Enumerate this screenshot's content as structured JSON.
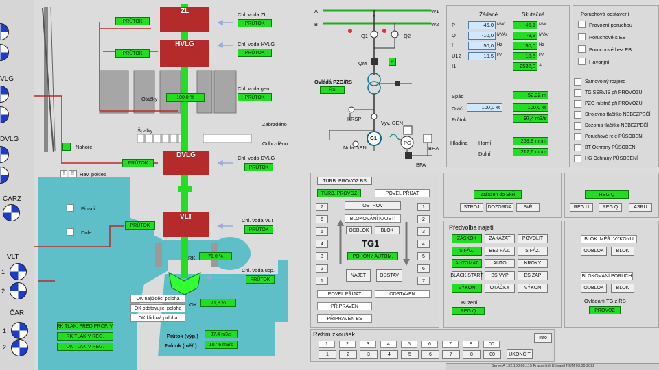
{
  "colors": {
    "green": "#22dd22",
    "red_block": "#b52b2b",
    "water": "#5fbfc9",
    "blue_indicator": "#1e3cc8"
  },
  "left": {
    "labels": [
      "VLG",
      "DVLG",
      "ČARZ",
      "VLT",
      "ČAR"
    ],
    "vlt_nums": [
      "1",
      "2"
    ],
    "car_nums": [
      "1",
      "2"
    ],
    "nahore": "Nahoře",
    "hav_pokles": "Hav. pokles",
    "hav_icons": [
      "!",
      "!!"
    ],
    "pinsci": "Pinsci",
    "dole": "Dole",
    "rk_labels": [
      "RK TLAK. PŘED PROP. V.",
      "RK TLAK V REG.",
      "OK TLAK V REG."
    ]
  },
  "turbine": {
    "zl": "ZL",
    "hvlg": "HVLG",
    "dvlg": "DVLG",
    "vlt": "VLT",
    "prutok": "PRŮTOK",
    "chl_zl": "Chl. voda ZL",
    "chl_hvlg": "Chl. voda HVLG",
    "chl_gen": "Chl. voda gen.",
    "chl_dvlg": "Chl. voda DVLG",
    "chl_vlt": "Chl. voda VLT",
    "chl_ucp": "Chl. voda ucp.",
    "otacky_label": "Otáčky",
    "otacky_val": "100,0 %",
    "spalky": "Špalky",
    "zabrzdeno": "Zabrzděno",
    "odbrzdeno": "Odbrzděno",
    "rk_label": "RK",
    "rk_val": "71,0 %",
    "ok_label": "OK",
    "ok_val": "71,8 %",
    "ok_positions": [
      "OK najížděcí poloha",
      "OK odstavující poloha",
      "OK klidová poloha"
    ],
    "prutok_vyp_label": "Průtok (výp.)",
    "prutok_vyp_val": "97,4 m3/s",
    "prutok_mer_label": "Průtok (měř.)",
    "prutok_mer_val": "107,6 m3/s"
  },
  "electric": {
    "a": "A",
    "b": "B",
    "w1": "W1",
    "w2": "W2",
    "five": "5",
    "q1": "Q1",
    "q2": "Q2",
    "qm": "QM",
    "p": "P",
    "ovlada": "Ovládá PZO/ŘS",
    "rs": "ŘS",
    "krsp": "KRSP",
    "vyv_gen": "Vyv. GEN",
    "g1": "G1",
    "nula_gen": "Nula GEN",
    "pg": "PG",
    "bha": "BHA",
    "bfa": "BFA"
  },
  "measure": {
    "head_zadane": "Žádané",
    "head_skutecne": "Skutečné",
    "rows": [
      {
        "name": "P",
        "set": "45,0",
        "set_u": "MW",
        "act": "45,1",
        "act_u": "MW"
      },
      {
        "name": "Q",
        "set": "-10,0",
        "set_u": "MVAr",
        "act": "-9,8",
        "act_u": "MVAr"
      },
      {
        "name": "f",
        "set": "50,0",
        "set_u": "Hz",
        "act": "50,0",
        "act_u": "Hz"
      },
      {
        "name": "U12",
        "set": "10,5",
        "set_u": "kV",
        "act": "10,5",
        "act_u": "kV"
      },
      {
        "name": "I1",
        "set": "",
        "set_u": "",
        "act": "2532,0",
        "act_u": "A"
      }
    ],
    "spad": "Spád",
    "spad_val": "52,32 m",
    "otac": "Otáč.",
    "otac_set": "100,0 %",
    "otac_act": "100,0 %",
    "prutok": "Průtok",
    "prutok_val": "97,4 m3/s",
    "hladina": "Hladina",
    "horni": "Horní",
    "horni_val": "269,9 mnm",
    "dolni": "Dolní",
    "dolni_val": "217,6 mnm"
  },
  "shutdown": {
    "title": "Poruchová odstavení",
    "items": [
      "Provozní poruchou",
      "Poruchové s EB",
      "Poruchové bez EB",
      "Havarijní"
    ],
    "items2": [
      "Samovolný rozjezd",
      "TG SERVIS při PROVOZU",
      "PZO místně při PROVOZU",
      "Strojovna tlačítko NEBEZPEČÍ",
      "Dozorna tlačítko NEBEZPEČÍ",
      "Poruchové relé PŮSOBENÍ",
      "BT Ochrany PŮSOBENÍ",
      "HG Ochrany PŮSOBENÍ"
    ]
  },
  "skr": {
    "zarazen": "Zařazen do SkŘ",
    "stroj": "STROJ",
    "dozorna": "DOZORNA",
    "skr": "SkŘ"
  },
  "reg": {
    "regq": "REG Q",
    "regu": "REG U",
    "regq2": "REG Q",
    "asru": "ASRU"
  },
  "tg": {
    "title": "TG1",
    "turb_bs": "TURB. PROVOZ BS",
    "turb_provoz": "TURB. PROVOZ",
    "povel_prijat": "POVEL PŘIJAT",
    "ostrov": "OSTROV",
    "blok_najeti": "BLOKOVÁNÍ NAJETÍ",
    "odblok": "ODBLOK",
    "blok": "BLOK",
    "pohony": "POHONY AUTOM.",
    "najet": "NAJET",
    "odstav": "ODSTAV",
    "povel_prijat2": "POVEL PŘIJAT",
    "odstaven": "ODSTAVEN",
    "pripraven": "PŘIPRAVEN",
    "pripraven_bs": "PŘIPRAVEN BS",
    "left_nums": [
      "7",
      "6",
      "5",
      "4",
      "3",
      "2",
      "1"
    ],
    "right_nums": [
      "1",
      "2",
      "3",
      "4",
      "5",
      "6",
      "7"
    ]
  },
  "predvolba": {
    "title": "Předvolba najetí",
    "rows": [
      [
        "ZÁSKOK",
        "ZAKÁZAT",
        "POVOLIT"
      ],
      [
        "S FÁZ.",
        "BEZ FÁZ.",
        "S FÁZ."
      ],
      [
        "AUTOMAT",
        "AUTO",
        "KROKY"
      ],
      [
        "BLACK START",
        "BS VYP",
        "BS ZAP"
      ],
      [
        "VÝKON",
        "OTÁČKY",
        "VÝKON"
      ]
    ],
    "buzeni": "Buzení",
    "reg_q": "REG Q"
  },
  "blok": {
    "mer": "BLOK. MĚŘ. VÝKONU",
    "odblok": "ODBLOK",
    "blok": "BLOK",
    "poruch": "BLOKOVÁNÍ PORUCH",
    "odblok2": "ODBLOK",
    "blok2": "BLOK",
    "ovladani": "Ovládání TG z ŘS",
    "provoz": "PROVOZ"
  },
  "rezim": {
    "title": "Režim zkoušek",
    "top": [
      "1",
      "2",
      "3",
      "4",
      "5",
      "6",
      "7",
      "8",
      "00"
    ],
    "bottom": [
      "1",
      "2",
      "3",
      "4",
      "5",
      "6",
      "7",
      "8",
      "00"
    ],
    "ukoncit": "UKONČIT",
    "info": "Info"
  },
  "status": "ServerA   192.168.86.115        Pracoviště   Uživatel  NUM  03.06.2022"
}
